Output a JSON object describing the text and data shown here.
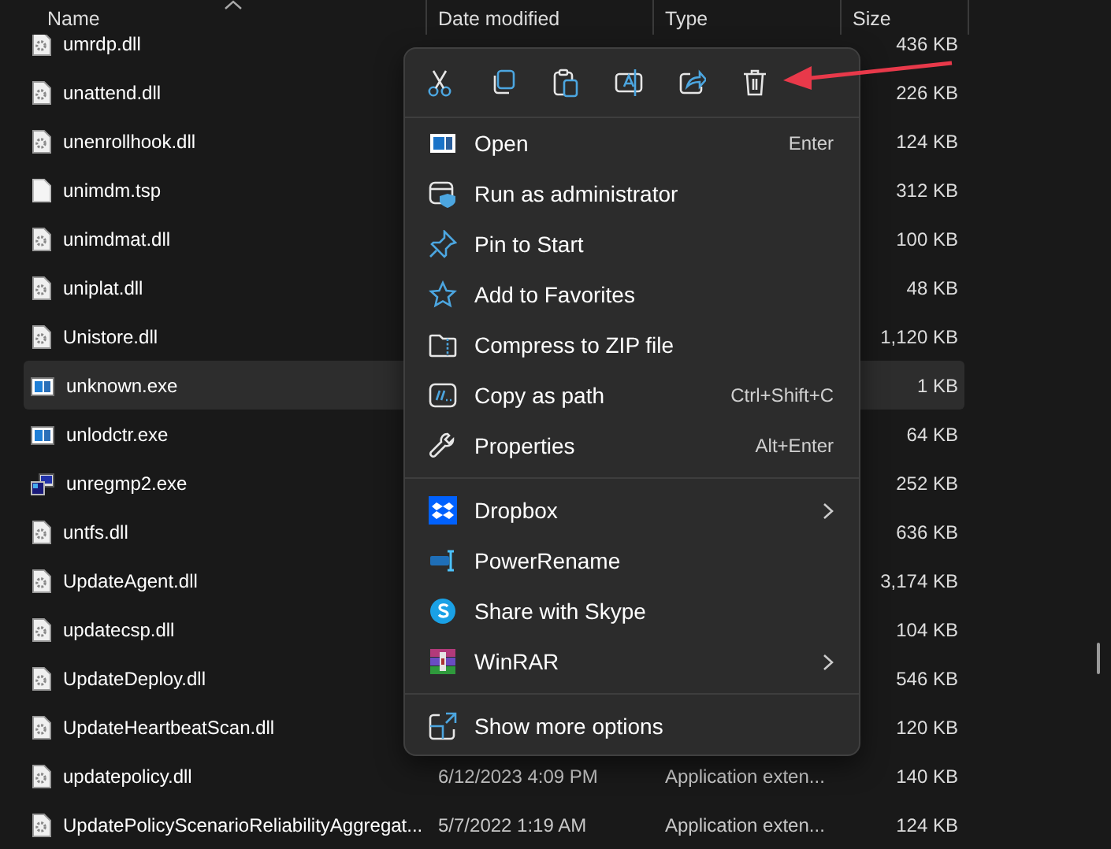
{
  "columns": [
    {
      "label": "Name"
    },
    {
      "label": "Date modified"
    },
    {
      "label": "Type"
    },
    {
      "label": "Size"
    }
  ],
  "files": [
    {
      "name": "umrdp.dll",
      "kind": "dll",
      "size": "436 KB",
      "selected": false
    },
    {
      "name": "unattend.dll",
      "kind": "dll",
      "size": "226 KB",
      "selected": false
    },
    {
      "name": "unenrollhook.dll",
      "kind": "dll",
      "size": "124 KB",
      "selected": false
    },
    {
      "name": "unimdm.tsp",
      "kind": "file",
      "size": "312 KB",
      "selected": false
    },
    {
      "name": "unimdmat.dll",
      "kind": "dll",
      "size": "100 KB",
      "selected": false
    },
    {
      "name": "uniplat.dll",
      "kind": "dll",
      "size": "48 KB",
      "selected": false
    },
    {
      "name": "Unistore.dll",
      "kind": "dll",
      "size": "1,120 KB",
      "selected": false
    },
    {
      "name": "unknown.exe",
      "kind": "exe",
      "size": "1 KB",
      "selected": true
    },
    {
      "name": "unlodctr.exe",
      "kind": "exe",
      "size": "64 KB",
      "selected": false
    },
    {
      "name": "unregmp2.exe",
      "kind": "installer",
      "size": "252 KB",
      "selected": false
    },
    {
      "name": "untfs.dll",
      "kind": "dll",
      "size": "636 KB",
      "selected": false
    },
    {
      "name": "UpdateAgent.dll",
      "kind": "dll",
      "size": "3,174 KB",
      "selected": false
    },
    {
      "name": "updatecsp.dll",
      "kind": "dll",
      "size": "104 KB",
      "selected": false
    },
    {
      "name": "UpdateDeploy.dll",
      "kind": "dll",
      "size": "546 KB",
      "selected": false
    },
    {
      "name": "UpdateHeartbeatScan.dll",
      "kind": "dll",
      "size": "120 KB",
      "selected": false
    },
    {
      "name": "updatepolicy.dll",
      "kind": "dll",
      "date": "6/12/2023 4:09 PM",
      "type": "Application exten...",
      "size": "140 KB",
      "selected": false
    },
    {
      "name": "UpdatePolicyScenarioReliabilityAggregat...",
      "kind": "dll",
      "date": "5/7/2022 1:19 AM",
      "type": "Application exten...",
      "size": "124 KB",
      "selected": false
    }
  ],
  "context_menu": {
    "sections": [
      [
        {
          "label": "Open",
          "shortcut": "Enter",
          "submenu": false
        },
        {
          "label": "Run as administrator",
          "submenu": false
        },
        {
          "label": "Pin to Start",
          "submenu": false
        },
        {
          "label": "Add to Favorites",
          "submenu": false
        },
        {
          "label": "Compress to ZIP file",
          "submenu": false
        },
        {
          "label": "Copy as path",
          "shortcut": "Ctrl+Shift+C",
          "submenu": false
        },
        {
          "label": "Properties",
          "shortcut": "Alt+Enter",
          "submenu": false
        }
      ],
      [
        {
          "label": "Dropbox",
          "submenu": true
        },
        {
          "label": "PowerRename",
          "submenu": false
        },
        {
          "label": "Share with Skype",
          "submenu": false
        },
        {
          "label": "WinRAR",
          "submenu": true
        }
      ],
      [
        {
          "label": "Show more options",
          "submenu": false
        }
      ]
    ]
  }
}
